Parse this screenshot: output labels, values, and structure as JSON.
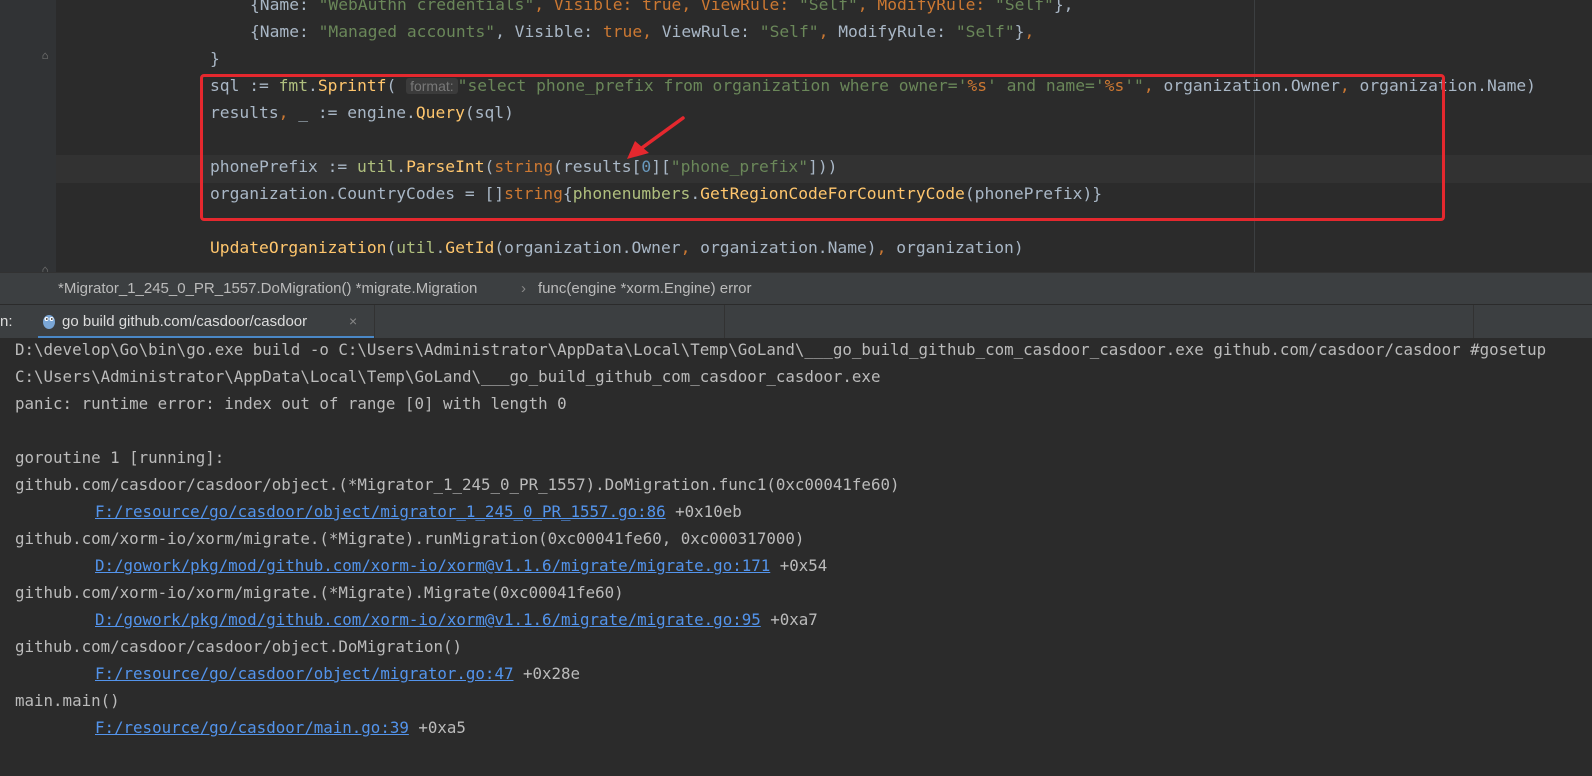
{
  "editor": {
    "lines": [
      {
        "pre": "{Name: ",
        "s1": "\"WebAuthn credentials\"",
        "a": ", Visible: ",
        "b": "true",
        "c": ", ViewRule: ",
        "s2": "\"Self\"",
        "d": ", ModifyRule: ",
        "s3": "\"Self\"",
        "e": "},"
      },
      {
        "pre": "{Name: ",
        "s1": "\"Managed accounts\"",
        "a": ", Visible: ",
        "b": "true",
        "c": ", ViewRule: ",
        "s2": "\"Self\"",
        "d": ", ModifyRule: ",
        "s3": "\"Self\"",
        "e": "},"
      }
    ],
    "close_brace": "}",
    "sql_line": {
      "var": "sql := ",
      "pkg": "fmt",
      "fn": "Sprintf",
      "hint": "format:",
      "str1": "\"select phone_prefix from organization where owner='",
      "fmt1": "%s",
      "str2": "' and name='",
      "fmt2": "%s",
      "str3": "'\"",
      "rest1": ", organization.Owner",
      "rest2": ", organization.Name)"
    },
    "results_line": {
      "a": "results",
      "b": ", ",
      "c": "_ := engine.",
      "fn": "Query",
      "d": "(sql)"
    },
    "phone_line": {
      "a": "phonePrefix := ",
      "pkg": "util",
      "b": ".",
      "fn": "ParseInt",
      "c": "(",
      "kw": "string",
      "d": "(results[",
      "num": "0",
      "e": "][",
      "str": "\"phone_prefix\"",
      "f": "]))"
    },
    "codes_line": {
      "a": "organization.CountryCodes = []",
      "kw": "string",
      "b": "{",
      "pkg": "phonenumbers",
      "c": ".",
      "fn": "GetRegionCodeForCountryCode",
      "d": "(phonePrefix)}"
    },
    "update_line": {
      "fn": "UpdateOrganization",
      "a": "(",
      "pkg": "util",
      "b": ".",
      "fn2": "GetId",
      "c": "(organization.Owner",
      "d": ", organization.Name)",
      "e": ", organization)"
    }
  },
  "breadcrumb": {
    "item1": "*Migrator_1_245_0_PR_1557.DoMigration() *migrate.Migration",
    "separator": "›",
    "item2": "func(engine *xorm.Engine) error"
  },
  "run_panel": {
    "label": "n:",
    "tab_title": "go build github.com/casdoor/casdoor",
    "close": "×"
  },
  "console": {
    "line1": "D:\\develop\\Go\\bin\\go.exe build -o C:\\Users\\Administrator\\AppData\\Local\\Temp\\GoLand\\___go_build_github_com_casdoor_casdoor.exe github.com/casdoor/casdoor #gosetup",
    "line2": "C:\\Users\\Administrator\\AppData\\Local\\Temp\\GoLand\\___go_build_github_com_casdoor_casdoor.exe",
    "line3": "panic: runtime error: index out of range [0] with length 0",
    "line5": "goroutine 1 [running]:",
    "line6": "github.com/casdoor/casdoor/object.(*Migrator_1_245_0_PR_1557).DoMigration.func1(0xc00041fe60)",
    "link7": "F:/resource/go/casdoor/object/migrator_1_245_0_PR_1557.go:86",
    "off7": " +0x10eb",
    "line8": "github.com/xorm-io/xorm/migrate.(*Migrate).runMigration(0xc00041fe60, 0xc000317000)",
    "link9": "D:/gowork/pkg/mod/github.com/xorm-io/xorm@v1.1.6/migrate/migrate.go:171",
    "off9": " +0x54",
    "line10": "github.com/xorm-io/xorm/migrate.(*Migrate).Migrate(0xc00041fe60)",
    "link11": "D:/gowork/pkg/mod/github.com/xorm-io/xorm@v1.1.6/migrate/migrate.go:95",
    "off11": " +0xa7",
    "line12": "github.com/casdoor/casdoor/object.DoMigration()",
    "link13": "F:/resource/go/casdoor/object/migrator.go:47",
    "off13": " +0x28e",
    "line14": "main.main()",
    "link15": "F:/resource/go/casdoor/main.go:39",
    "off15": " +0xa5"
  },
  "colors": {
    "highlight_box": "#e5282e",
    "arrow": "#e5282e",
    "link": "#5394ec"
  }
}
